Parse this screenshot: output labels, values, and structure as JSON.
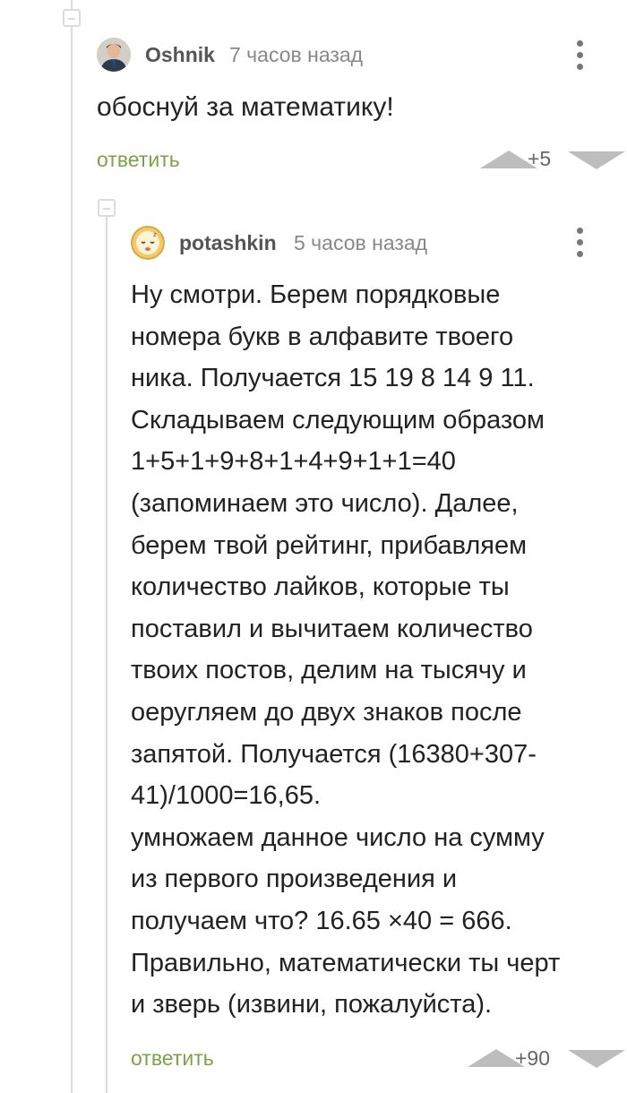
{
  "comments": [
    {
      "author": "Oshnik",
      "time": "7 часов назад",
      "text": "обоснуй за математику!",
      "reply_label": "ответить",
      "rating": "+5",
      "avatar_icon": "user-photo-avatar"
    },
    {
      "author": "potashkin",
      "time": "5 часов назад",
      "text": "Ну смотри. Берем порядковые\nномера букв в алфавите твоего\nника. Получается 15 19 8 14 9 11.\nСкладываем следующим образом\n1+5+1+9+8+1+4+9+1+1=40\n(запоминаем это число). Далее,\nберем твой рейтинг, прибавляем\nколичество лайков, которые ты\nпоставил и вычитаем количество\nтвоих постов, делим на тысячу и\nоеругляем до двух знаков после\nзапятой. Получается (16380+307-\n41)/1000=16,65.\nумножаем данное число на сумму\nиз первого произведения и\nполучаем что? 16.65 ×40 = 666.\nПравильно, математически ты черт\nи зверь (извини, пожалуйста).",
      "reply_label": "ответить",
      "rating": "+90",
      "avatar_icon": "sleeping-emoji-avatar"
    }
  ],
  "colors": {
    "reply": "#7aa346",
    "vote_arrow": "#bdbdbd",
    "thread_line": "#dcdcdc"
  }
}
